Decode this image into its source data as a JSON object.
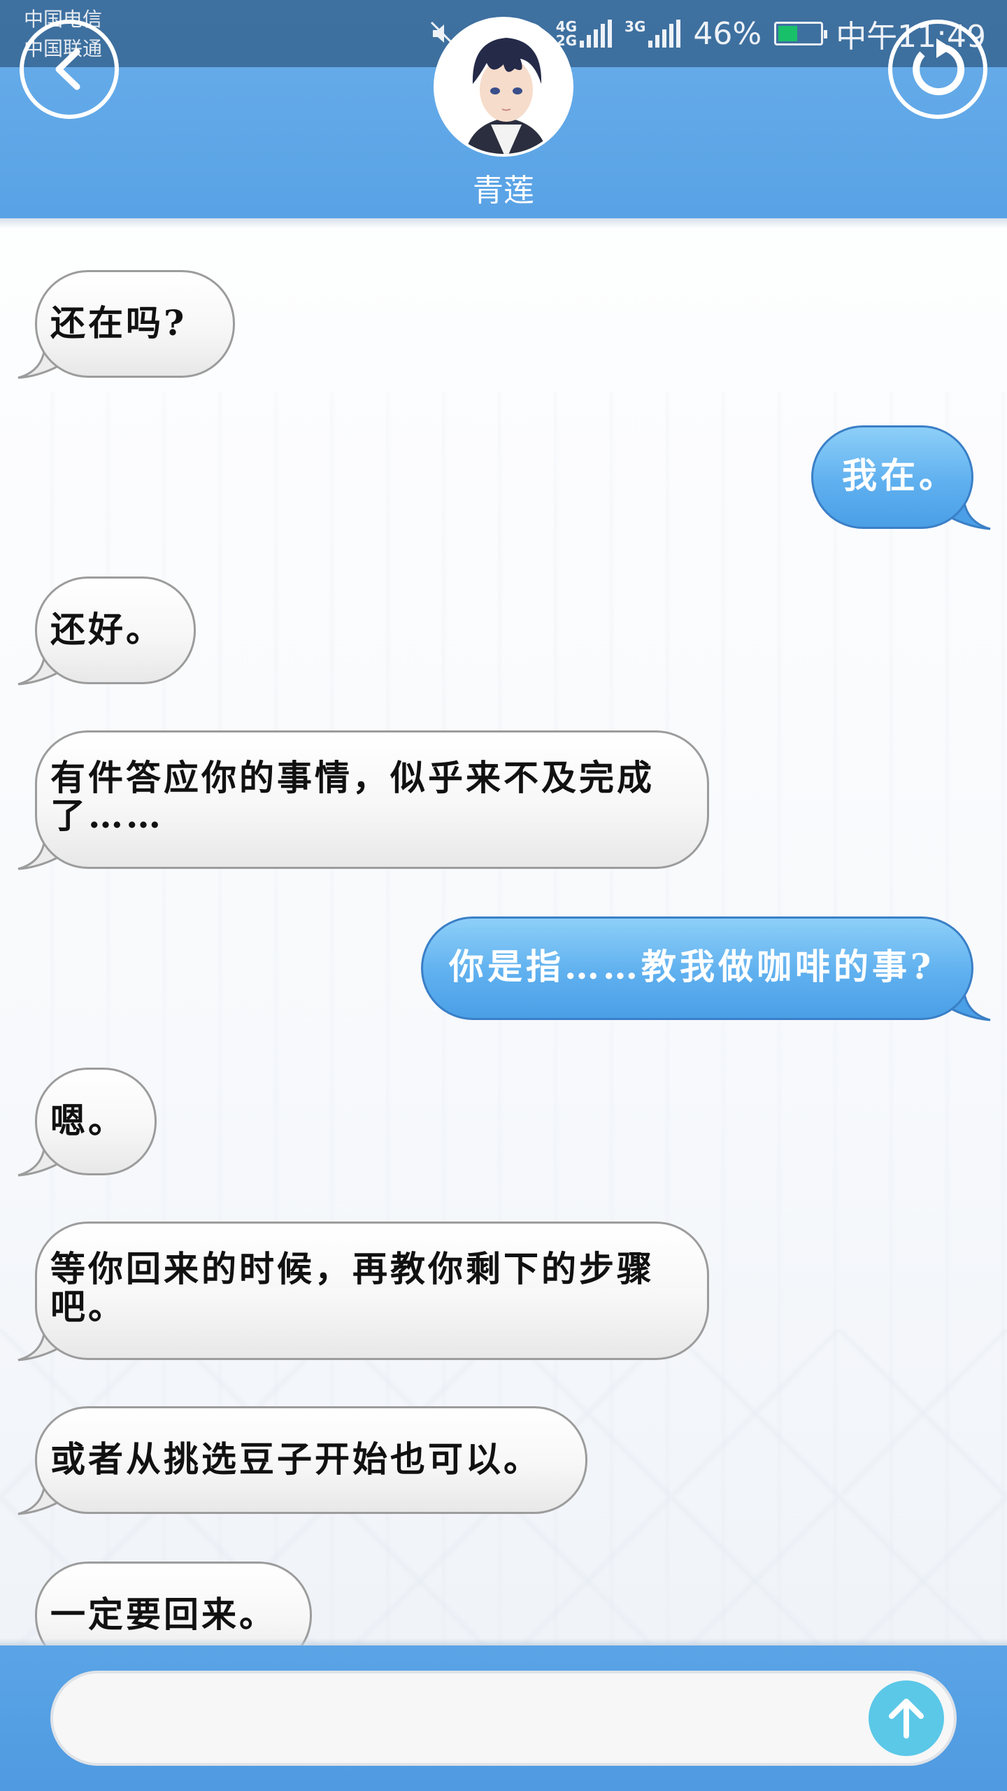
{
  "status_bar": {
    "carrier_1": "中国电信",
    "carrier_2": "中国联通",
    "net_1_top": "4G",
    "net_1_bottom": "2G",
    "net_2": "3G",
    "battery_percent": "46%",
    "battery_level": 0.46,
    "time": "中午11:49",
    "icons": [
      "mute-icon",
      "alarm-icon",
      "wifi-icon",
      "signal-icon",
      "signal-icon",
      "battery-icon"
    ]
  },
  "header": {
    "contact_name": "青莲",
    "back_icon": "chevron-left-icon",
    "refresh_icon": "refresh-icon"
  },
  "messages": [
    {
      "side": "incoming",
      "text": "还在吗?"
    },
    {
      "side": "outgoing",
      "text": "我在。"
    },
    {
      "side": "incoming",
      "text": "还好。"
    },
    {
      "side": "incoming",
      "text_line1": "有件答应你的事情，似乎来不及完成",
      "text_line2": "了……"
    },
    {
      "side": "outgoing",
      "text": "你是指……教我做咖啡的事?"
    },
    {
      "side": "incoming",
      "text": "嗯。"
    },
    {
      "side": "incoming",
      "text_line1": "等你回来的时候，再教你剩下的步骤",
      "text_line2": "吧。"
    },
    {
      "side": "incoming",
      "text": "或者从挑选豆子开始也可以。"
    },
    {
      "side": "incoming",
      "text": "一定要回来。"
    }
  ],
  "composer": {
    "placeholder": "",
    "send_icon": "arrow-up-icon"
  },
  "colors": {
    "header_blue": "#58a2e5",
    "outgoing_bubble": "#5fb0ef",
    "incoming_bubble": "#f2f2f2",
    "send_button": "#5bc8e8"
  }
}
